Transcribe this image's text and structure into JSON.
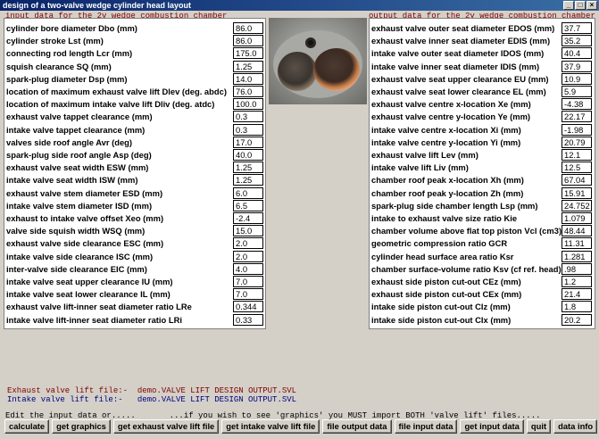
{
  "window": {
    "title": "design of a two-valve wedge cylinder head layout"
  },
  "input_header": "input data for the 2v wedge combustion chamber",
  "output_header": "output data for the 2v wedge combustion chamber",
  "inputs": [
    {
      "label": "cylinder bore diameter Dbo (mm)",
      "value": "86.0"
    },
    {
      "label": "cylinder stroke Lst (mm)",
      "value": "86.0"
    },
    {
      "label": "connecting rod length Lcr (mm)",
      "value": "175.0"
    },
    {
      "label": "squish clearance SQ (mm)",
      "value": "1.25"
    },
    {
      "label": "spark-plug diameter Dsp (mm)",
      "value": "14.0"
    },
    {
      "label": "location of maximum exhaust valve lift Dlev (deg. abdc)",
      "value": "76.0"
    },
    {
      "label": "location of maximum intake valve lift Dliv (deg. atdc)",
      "value": "100.0"
    },
    {
      "label": "exhaust valve tappet clearance (mm)",
      "value": "0.3"
    },
    {
      "label": "intake valve tappet clearance (mm)",
      "value": "0.3"
    },
    {
      "label": "valves side roof angle Avr (deg)",
      "value": "17.0"
    },
    {
      "label": "spark-plug side roof angle Asp (deg)",
      "value": "40.0"
    },
    {
      "label": "exhaust valve seat width ESW (mm)",
      "value": "1.25"
    },
    {
      "label": "intake valve seat width ISW (mm)",
      "value": "1.25"
    },
    {
      "label": "exhaust valve stem diameter ESD (mm)",
      "value": "6.0"
    },
    {
      "label": "intake valve stem diameter ISD (mm)",
      "value": "6.5"
    },
    {
      "label": "exhaust to intake valve offset Xeo (mm)",
      "value": "-2.4"
    },
    {
      "label": "valve side squish width WSQ (mm)",
      "value": "15.0"
    },
    {
      "label": "exhaust valve side clearance ESC (mm)",
      "value": "2.0"
    },
    {
      "label": "intake valve side clearance ISC (mm)",
      "value": "2.0"
    },
    {
      "label": "inter-valve side clearance EIC (mm)",
      "value": "4.0"
    },
    {
      "label": "intake valve seat upper clearance IU (mm)",
      "value": "7.0"
    },
    {
      "label": "intake valve seat lower clearance IL (mm)",
      "value": "7.0"
    },
    {
      "label": "exhaust valve lift-inner seat diameter ratio LRe",
      "value": "0.344"
    },
    {
      "label": "intake valve lift-inner seat diameter ratio LRi",
      "value": "0.33"
    }
  ],
  "outputs": [
    {
      "label": "exhaust valve outer seat diameter EDOS (mm)",
      "value": "37.7"
    },
    {
      "label": "exhaust valve inner seat diameter EDIS (mm)",
      "value": "35.2"
    },
    {
      "label": "intake valve outer seat diameter IDOS (mm)",
      "value": "40.4"
    },
    {
      "label": "intake valve inner seat diameter IDIS (mm)",
      "value": "37.9"
    },
    {
      "label": "exhaust valve seat upper clearance EU (mm)",
      "value": "10.9"
    },
    {
      "label": "exhaust valve seat lower clearance EL (mm)",
      "value": "5.9"
    },
    {
      "label": "exhaust valve centre x-location Xe (mm)",
      "value": "-4.38"
    },
    {
      "label": "exhaust valve centre y-location Ye (mm)",
      "value": "22.17"
    },
    {
      "label": "intake valve centre x-location Xi (mm)",
      "value": "-1.98"
    },
    {
      "label": "intake valve centre y-location Yi (mm)",
      "value": "20.79"
    },
    {
      "label": "exhaust valve lift Lev (mm)",
      "value": "12.1"
    },
    {
      "label": "intake valve lift Liv (mm)",
      "value": "12.5"
    },
    {
      "label": "chamber roof peak x-location Xh (mm)",
      "value": "67.04"
    },
    {
      "label": "chamber roof peak y-location Zh (mm)",
      "value": "15.91"
    },
    {
      "label": "spark-plug side chamber length Lsp (mm)",
      "value": "24.752"
    },
    {
      "label": "intake to exhaust valve size ratio Kie",
      "value": "1.079"
    },
    {
      "label": "chamber volume above flat top piston Vcl (cm3)",
      "value": "48.44"
    },
    {
      "label": "geometric compression ratio GCR",
      "value": "11.31"
    },
    {
      "label": "cylinder head surface area ratio Ksr",
      "value": "1.281"
    },
    {
      "label": "chamber surface-volume ratio Ksv (cf ref. head)",
      "value": ".98"
    },
    {
      "label": "exhaust side piston cut-out CEz (mm)",
      "value": "1.2"
    },
    {
      "label": "exhaust side piston cut-out CEx (mm)",
      "value": "21.4"
    },
    {
      "label": "intake side piston cut-out CIz (mm)",
      "value": "1.8"
    },
    {
      "label": "intake side piston cut-out CIx (mm)",
      "value": "20.2"
    }
  ],
  "files": {
    "exhaust_label": "Exhaust valve lift file:-",
    "exhaust_value": "demo.VALVE LIFT DESIGN OUTPUT.SVL",
    "intake_label": "Intake valve lift file:-",
    "intake_value": "demo.VALVE LIFT DESIGN OUTPUT.SVL"
  },
  "hint": "Edit the input data or.....       ...if you wish to see 'graphics' you MUST import BOTH 'valve lift' files.....",
  "buttons": [
    "calculate",
    "get graphics",
    "get exhaust valve lift file",
    "get intake valve lift file",
    "file output data",
    "file input data",
    "get input data",
    "quit",
    "data info"
  ],
  "colors": {
    "title_bar": "#0a246a",
    "header_text": "#800000",
    "exhaust_file_text": "#800000",
    "intake_file_text": "#000080"
  }
}
